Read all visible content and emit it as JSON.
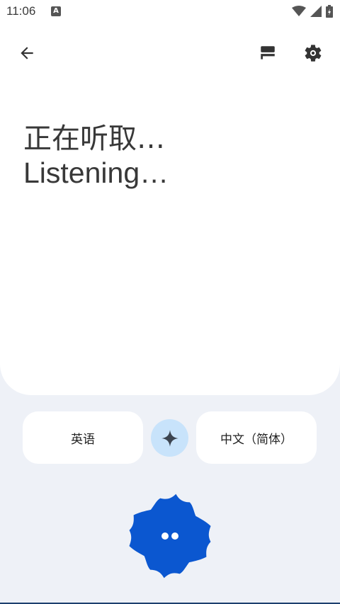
{
  "status": {
    "time": "11:06",
    "notification_letter": "A"
  },
  "header": {
    "back_icon": "arrow-back-icon",
    "history_icon": "history-cards-icon",
    "settings_icon": "gear-icon"
  },
  "transcript": {
    "line1": "正在听取…",
    "line2": "Listening…"
  },
  "languages": {
    "source": "英语",
    "target": "中文（简体）",
    "swap_icon": "sparkle-icon"
  },
  "mic": {
    "icon": "listening-dots-icon"
  },
  "colors": {
    "background": "#eef1f7",
    "card": "#ffffff",
    "swap_bg": "#c8e3fb",
    "mic_blue": "#0b57d0"
  }
}
